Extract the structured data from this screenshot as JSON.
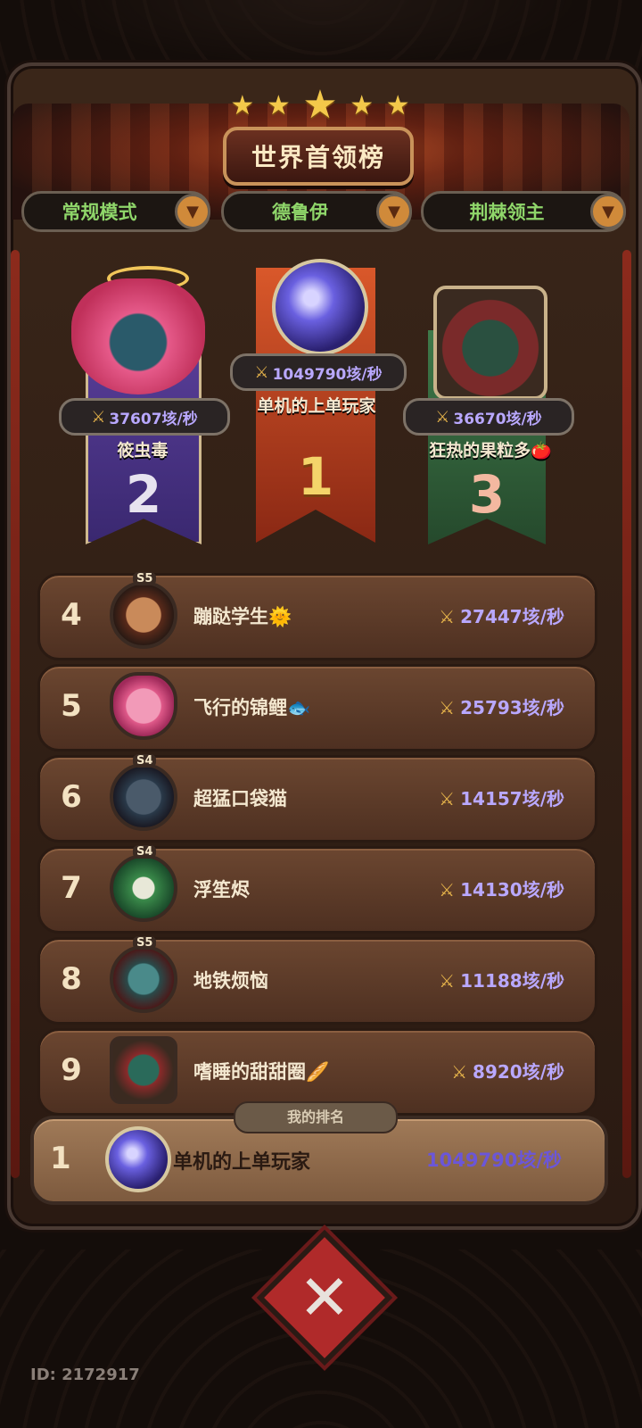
{
  "header": {
    "title": "世界首领榜",
    "stars": [
      "★",
      "★",
      "★",
      "★",
      "★"
    ]
  },
  "filters": [
    {
      "label": "常规模式"
    },
    {
      "label": "德鲁伊"
    },
    {
      "label": "荆棘领主"
    }
  ],
  "podium": {
    "first": {
      "rank": "1",
      "name": "单机的上单玩家",
      "score": "1049790垓/秒"
    },
    "second": {
      "rank": "2",
      "name": "筱虫毒",
      "score": "37607垓/秒"
    },
    "third": {
      "rank": "3",
      "name": "狂热的果粒多🍅",
      "score": "36670垓/秒"
    }
  },
  "list": [
    {
      "rank": "4",
      "badge": "S5",
      "name": "蹦跶学生🌞",
      "score": "27447垓/秒",
      "avatar_color": "#8a4a2a"
    },
    {
      "rank": "5",
      "badge": "",
      "name": "飞行的锦鲤🐟",
      "score": "25793垓/秒",
      "avatar_color": "#e05a8a"
    },
    {
      "rank": "6",
      "badge": "S4",
      "name": "超猛口袋猫",
      "score": "14157垓/秒",
      "avatar_color": "#2a3a4a"
    },
    {
      "rank": "7",
      "badge": "S4",
      "name": "浮笙烬",
      "score": "14130垓/秒",
      "avatar_color": "#2a6a3a"
    },
    {
      "rank": "8",
      "badge": "S5",
      "name": "地铁烦恼",
      "score": "11188垓/秒",
      "avatar_color": "#2a4a4a"
    },
    {
      "rank": "9",
      "badge": "",
      "name": "嗜睡的甜甜圈🥖",
      "score": "8920垓/秒",
      "avatar_color": "#7a2a2a"
    }
  ],
  "my_rank": {
    "tag": "我的排名",
    "rank": "1",
    "name": "单机的上单玩家",
    "score": "1049790垓/秒"
  },
  "footer": {
    "id_text": "ID: 2172917"
  },
  "icons": {
    "sword": "swords-icon",
    "arrow": "dropdown-arrow-icon",
    "close": "close-icon"
  }
}
